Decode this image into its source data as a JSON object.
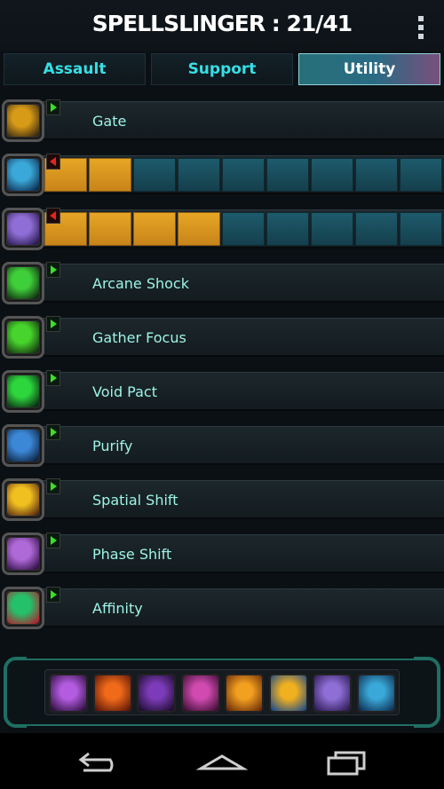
{
  "header": {
    "title": "SPELLSLINGER : 21/41",
    "menu_icon": "overflow-menu-icon"
  },
  "tabs": [
    {
      "label": "Assault",
      "selected": false
    },
    {
      "label": "Support",
      "selected": false
    },
    {
      "label": "Utility",
      "selected": true
    }
  ],
  "abilities": [
    {
      "label": "Gate",
      "icon": "gate-icon",
      "art": "#d89b18",
      "art2": "#3a2a10",
      "arrow": "green"
    },
    {
      "label": "",
      "icon": "arcane-burst-icon",
      "art": "#3aa8d8",
      "art2": "#0d2e52",
      "arrow": "red",
      "progress_fraction": 0.2
    },
    {
      "label": "",
      "icon": "specter-icon",
      "art": "#8f6fd6",
      "art2": "#2a1850",
      "arrow": "red",
      "progress_fraction": 0.4
    },
    {
      "label": "Arcane Shock",
      "icon": "arcane-shock-icon",
      "art": "#3fcf3a",
      "art2": "#0f2a10",
      "arrow": "green"
    },
    {
      "label": "Gather Focus",
      "icon": "gather-focus-icon",
      "art": "#47d42c",
      "art2": "#143010",
      "arrow": "green"
    },
    {
      "label": "Void Pact",
      "icon": "void-pact-icon",
      "art": "#2ed63e",
      "art2": "#0a2a12",
      "arrow": "green"
    },
    {
      "label": "Purify",
      "icon": "purify-icon",
      "art": "#3c88d6",
      "art2": "#0c2240",
      "arrow": "green"
    },
    {
      "label": "Spatial Shift",
      "icon": "spatial-shift-icon",
      "art": "#f0c020",
      "art2": "#5a2a10",
      "arrow": "green"
    },
    {
      "label": "Phase Shift",
      "icon": "phase-shift-icon",
      "art": "#b06ad8",
      "art2": "#34104a",
      "arrow": "green"
    },
    {
      "label": "Affinity",
      "icon": "affinity-icon",
      "art": "#25c06a",
      "art2": "#b02030",
      "arrow": "green"
    }
  ],
  "loadout": {
    "slots": [
      {
        "icon": "void-orb-icon",
        "c1": "#b35ce0",
        "c2": "#2a0c3a"
      },
      {
        "icon": "flame-script-icon",
        "c1": "#f06a1a",
        "c2": "#5a1408"
      },
      {
        "icon": "shadow-dash-icon",
        "c1": "#7c3bb8",
        "c2": "#1a0c2a"
      },
      {
        "icon": "spore-icon",
        "c1": "#d04ab0",
        "c2": "#3a0c30"
      },
      {
        "icon": "flame-swirl-icon",
        "c1": "#f2a020",
        "c2": "#6a2a08"
      },
      {
        "icon": "lightning-icon",
        "c1": "#f0b020",
        "c2": "#1a4a8a"
      },
      {
        "icon": "specter-icon",
        "c1": "#8f6fd6",
        "c2": "#2a1850"
      },
      {
        "icon": "arcane-burst-icon",
        "c1": "#3aa8d8",
        "c2": "#0d2e52"
      }
    ]
  },
  "navbar": {
    "back": "back-icon",
    "home": "home-icon",
    "recents": "recents-icon"
  }
}
